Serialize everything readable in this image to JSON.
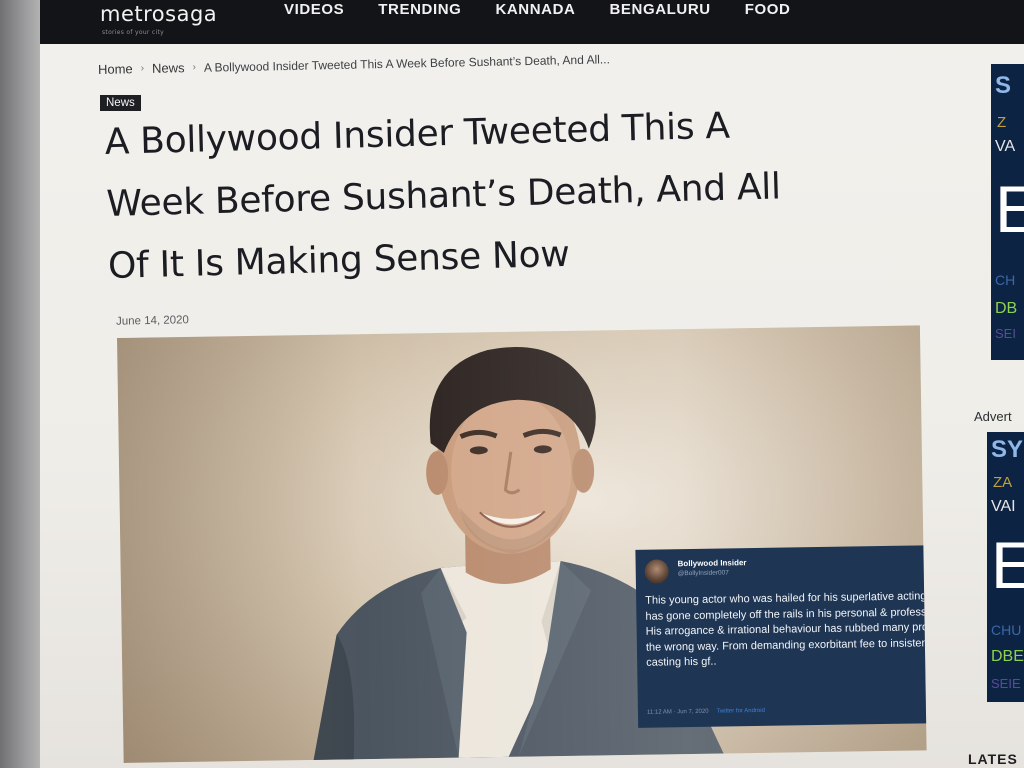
{
  "site": {
    "logo": "metrosaga",
    "tagline": "stories of your city"
  },
  "nav": {
    "items": [
      "VIDEOS",
      "TRENDING",
      "KANNADA",
      "BENGALURU",
      "FOOD"
    ]
  },
  "breadcrumb": {
    "items": [
      "Home",
      "News"
    ],
    "current": "A Bollywood Insider Tweeted This A Week Before Sushant’s Death, And All..."
  },
  "article": {
    "category": "News",
    "headline_lines": [
      "A Bollywood Insider Tweeted This A",
      "Week Before Sushant’s Death, And All",
      "Of It Is Making Sense Now"
    ],
    "date": "June 14, 2020"
  },
  "tweet": {
    "name": "Bollywood Insider",
    "handle": "@BollyInsider007",
    "body": "This young actor who was hailed for his superlative acting finesse has gone completely off the rails in his personal & professional life. His arrogance & irrational behaviour has rubbed many producers the wrong way. From demanding exorbitant fee to insistence on casting his gf..",
    "time": "11:12 AM · Jun 7, 2020",
    "link": "Twitter for Android"
  },
  "sidebar": {
    "ad_label": "Advert",
    "latest_label": "LATES",
    "ad1": {
      "sym": "S",
      "z": "Z",
      "va": "VA",
      "big": "E",
      "ch": "CH",
      "db": "DB",
      "se": "SEI"
    },
    "ad2": {
      "sym": "SY",
      "z": "ZA",
      "va": "VAI",
      "big": "E",
      "ch": "CHU",
      "db": "DBE",
      "se": "SEIE"
    }
  },
  "colors": {
    "navbar": "#121417",
    "tweet_bg": "#1e3554",
    "ad_bg": "#0d2344",
    "badge_bg": "#1d1f22"
  }
}
